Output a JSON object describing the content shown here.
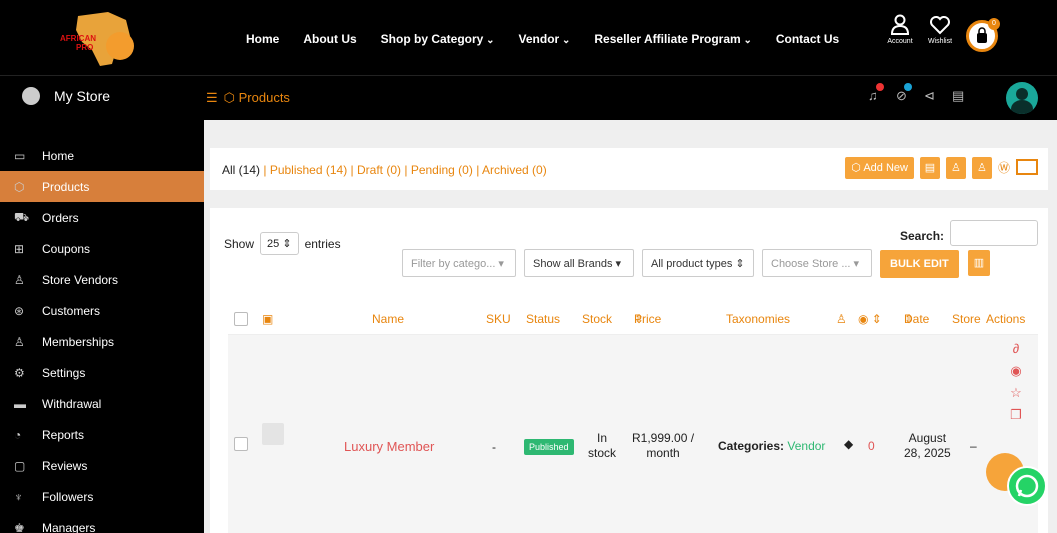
{
  "brand": {
    "logo_text_1": "AFRICAN",
    "logo_text_2": "PRO"
  },
  "nav": {
    "links": [
      "Home",
      "About Us",
      "Shop by Category",
      "Vendor",
      "Reseller Affiliate Program",
      "Contact Us"
    ],
    "account_label": "Account",
    "wishlist_label": "Wishlist",
    "cart_count": "0"
  },
  "store": {
    "title": "My Store",
    "breadcrumb": "Products"
  },
  "sidebar": {
    "items": [
      {
        "label": "Home",
        "icon": "monitor-icon"
      },
      {
        "label": "Products",
        "icon": "cube-icon",
        "active": true
      },
      {
        "label": "Orders",
        "icon": "cart-icon"
      },
      {
        "label": "Coupons",
        "icon": "gift-icon"
      },
      {
        "label": "Store Vendors",
        "icon": "user-icon"
      },
      {
        "label": "Customers",
        "icon": "customer-icon"
      },
      {
        "label": "Memberships",
        "icon": "user-plus-icon"
      },
      {
        "label": "Settings",
        "icon": "gears-icon"
      },
      {
        "label": "Withdrawal",
        "icon": "card-icon"
      },
      {
        "label": "Reports",
        "icon": "pie-icon"
      },
      {
        "label": "Reviews",
        "icon": "comment-icon"
      },
      {
        "label": "Followers",
        "icon": "follower-icon"
      },
      {
        "label": "Managers",
        "icon": "manager-icon"
      }
    ]
  },
  "status_filters": {
    "all": "All (14)",
    "published": "Published (14)",
    "draft": "Draft (0)",
    "pending": "Pending (0)",
    "archived": "Archived (0)"
  },
  "actions": {
    "add_new": "Add New"
  },
  "table_controls": {
    "show": "Show",
    "entries_value": "25",
    "entries": "entries",
    "search_label": "Search:",
    "filter_category": "Filter by catego...",
    "filter_brands": "Show all Brands",
    "filter_types": "All product types",
    "filter_store": "Choose Store ...",
    "bulk_edit": "BULK EDIT"
  },
  "table": {
    "headers": {
      "name": "Name",
      "sku": "SKU",
      "status": "Status",
      "stock": "Stock",
      "price": "Price",
      "taxonomies": "Taxonomies",
      "date": "Date",
      "store": "Store",
      "actions": "Actions"
    },
    "rows": [
      {
        "name": "Luxury Member",
        "sku": "-",
        "status": "Published",
        "stock_line1": "In",
        "stock_line2": "stock",
        "price_line1": "R1,999.00 /",
        "price_line2": "month",
        "categories_label": "Categories:",
        "categories_value": "Vendor",
        "views": "0",
        "date_line1": "August",
        "date_line2": "28, 2025",
        "store": "–"
      }
    ]
  },
  "colors": {
    "accent": "#e8860f",
    "active_side": "#d77f3b",
    "published": "#2eb872"
  }
}
